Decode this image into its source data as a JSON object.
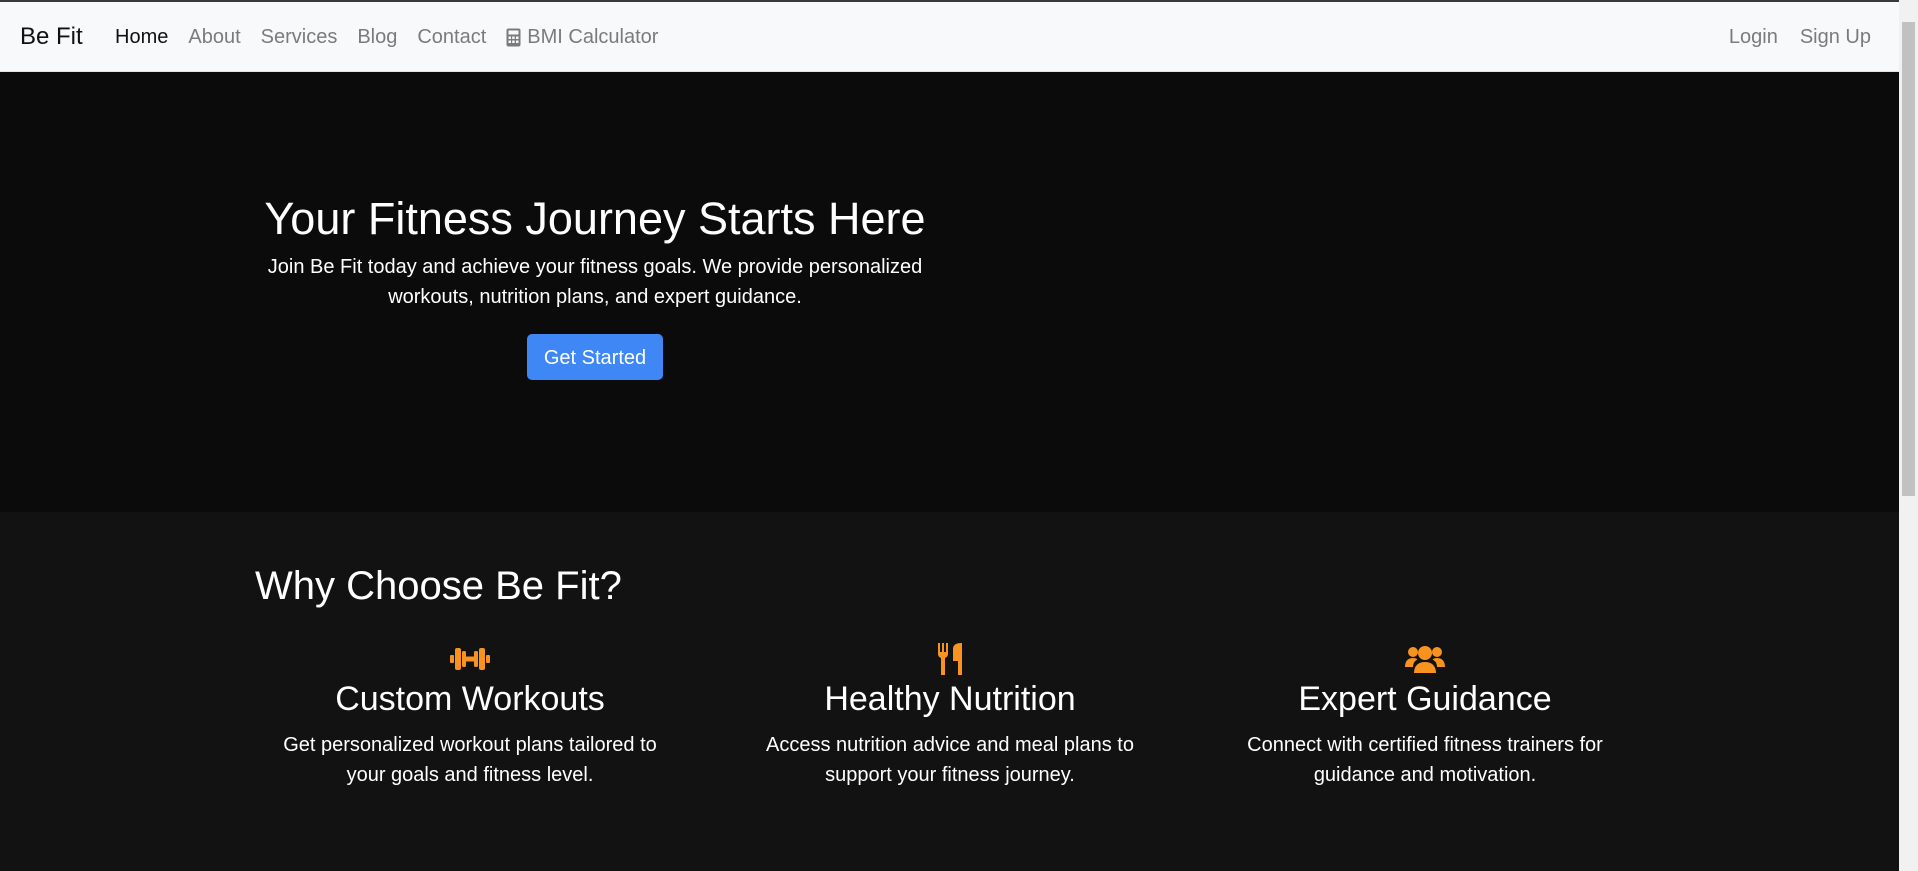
{
  "navbar": {
    "brand": "Be Fit",
    "links": [
      {
        "label": "Home",
        "active": true
      },
      {
        "label": "About"
      },
      {
        "label": "Services"
      },
      {
        "label": "Blog"
      },
      {
        "label": "Contact"
      },
      {
        "label": "BMI Calculator",
        "icon": "calculator-icon"
      }
    ],
    "right_links": [
      {
        "label": "Login"
      },
      {
        "label": "Sign Up"
      }
    ]
  },
  "hero": {
    "title": "Your Fitness Journey Starts Here",
    "text": "Join Be Fit today and achieve your fitness goals. We provide personalized workouts, nutrition plans, and expert guidance.",
    "button": "Get Started"
  },
  "features": {
    "title": "Why Choose Be Fit?",
    "items": [
      {
        "icon": "dumbbell-icon",
        "title": "Custom Workouts",
        "text": "Get personalized workout plans tailored to your goals and fitness level."
      },
      {
        "icon": "utensils-icon",
        "title": "Healthy Nutrition",
        "text": "Access nutrition advice and meal plans to support your fitness journey."
      },
      {
        "icon": "users-icon",
        "title": "Expert Guidance",
        "text": "Connect with certified fitness trainers for guidance and motivation."
      }
    ]
  },
  "colors": {
    "accent_orange": "#f7931e",
    "primary_button": "#3f87f5",
    "hero_bg": "#0b0b0b",
    "features_bg": "#121212",
    "navbar_bg": "#f8f9fa"
  }
}
